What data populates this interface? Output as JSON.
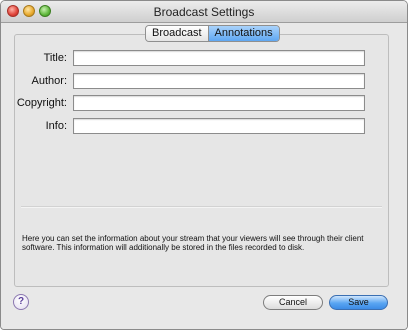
{
  "window": {
    "title": "Broadcast Settings"
  },
  "tabs": [
    {
      "label": "Broadcast",
      "selected": false
    },
    {
      "label": "Annotations",
      "selected": true
    }
  ],
  "form": {
    "fields": [
      {
        "label": "Title:",
        "value": ""
      },
      {
        "label": "Author:",
        "value": ""
      },
      {
        "label": "Copyright:",
        "value": ""
      },
      {
        "label": "Info:",
        "value": ""
      }
    ]
  },
  "info_text": "Here you can set the information about your stream that your viewers will see through their client software.  This information will additionally be stored in the files recorded to disk.",
  "footer": {
    "help_label": "?",
    "cancel_label": "Cancel",
    "save_label": "Save"
  },
  "colors": {
    "accent": "#5fa7f2",
    "window_bg": "#e8e8e8"
  },
  "icons": {
    "close": "close-icon",
    "minimize": "minimize-icon",
    "zoom": "zoom-icon",
    "help": "help-icon"
  }
}
